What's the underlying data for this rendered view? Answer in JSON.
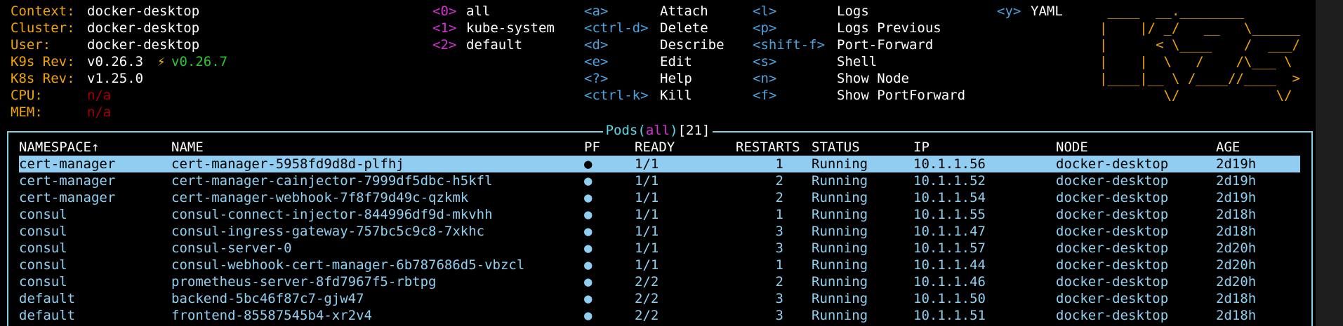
{
  "info": [
    {
      "label": "Context:",
      "value": "docker-desktop"
    },
    {
      "label": "Cluster:",
      "value": "docker-desktop"
    },
    {
      "label": "User:",
      "value": "docker-desktop"
    },
    {
      "label": "K9s Rev:",
      "value": "v0.26.3",
      "upgrade_icon": "⚡",
      "upgrade": "v0.26.7"
    },
    {
      "label": "K8s Rev:",
      "value": "v1.25.0"
    },
    {
      "label": "CPU:",
      "value": "n/a"
    },
    {
      "label": "MEM:",
      "value": "n/a"
    }
  ],
  "namespaces": [
    {
      "key": "<0>",
      "name": "all"
    },
    {
      "key": "<1>",
      "name": "kube-system"
    },
    {
      "key": "<2>",
      "name": "default"
    }
  ],
  "shortcuts_col1": [
    {
      "key": "<a>",
      "cmd": "Attach"
    },
    {
      "key": "<ctrl-d>",
      "cmd": "Delete"
    },
    {
      "key": "<d>",
      "cmd": "Describe"
    },
    {
      "key": "<e>",
      "cmd": "Edit"
    },
    {
      "key": "<?>",
      "cmd": "Help"
    },
    {
      "key": "<ctrl-k>",
      "cmd": "Kill"
    }
  ],
  "shortcuts_col2": [
    {
      "key": "<l>",
      "cmd": "Logs"
    },
    {
      "key": "<p>",
      "cmd": "Logs Previous"
    },
    {
      "key": "<shift-f>",
      "cmd": "Port-Forward"
    },
    {
      "key": "<s>",
      "cmd": "Shell"
    },
    {
      "key": "<n>",
      "cmd": "Show Node"
    },
    {
      "key": "<f>",
      "cmd": "Show PortForward"
    }
  ],
  "shortcuts_col3": [
    {
      "key": "<y>",
      "cmd": "YAML"
    }
  ],
  "logo_lines": [
    " ____  __.________        ",
    "|    |/ _/   __   \\______ ",
    "|      < \\____    /  ___/ ",
    "|    |  \\   /    /\\___ \\  ",
    "|____|__ \\ /____//____  > ",
    "        \\/            \\/  "
  ],
  "pods_panel": {
    "resource": "Pods",
    "scope": "all",
    "count": "21"
  },
  "columns": {
    "namespace": "NAMESPACE↑",
    "name": "NAME",
    "pf": "PF",
    "ready": "READY",
    "restarts": "RESTARTS",
    "status": "STATUS",
    "ip": "IP",
    "node": "NODE",
    "age": "AGE"
  },
  "rows": [
    {
      "namespace": "cert-manager",
      "name": "cert-manager-5958fd9d8d-plfhj",
      "pf": "●",
      "ready": "1/1",
      "restarts": "1",
      "status": "Running",
      "ip": "10.1.1.56",
      "node": "docker-desktop",
      "age": "2d19h"
    },
    {
      "namespace": "cert-manager",
      "name": "cert-manager-cainjector-7999df5dbc-h5kfl",
      "pf": "●",
      "ready": "1/1",
      "restarts": "2",
      "status": "Running",
      "ip": "10.1.1.52",
      "node": "docker-desktop",
      "age": "2d19h"
    },
    {
      "namespace": "cert-manager",
      "name": "cert-manager-webhook-7f8f79d49c-qzkmk",
      "pf": "●",
      "ready": "1/1",
      "restarts": "2",
      "status": "Running",
      "ip": "10.1.1.54",
      "node": "docker-desktop",
      "age": "2d19h"
    },
    {
      "namespace": "consul",
      "name": "consul-connect-injector-844996df9d-mkvhh",
      "pf": "●",
      "ready": "1/1",
      "restarts": "1",
      "status": "Running",
      "ip": "10.1.1.55",
      "node": "docker-desktop",
      "age": "2d18h"
    },
    {
      "namespace": "consul",
      "name": "consul-ingress-gateway-757bc5c9c8-7xkhc",
      "pf": "●",
      "ready": "1/1",
      "restarts": "3",
      "status": "Running",
      "ip": "10.1.1.47",
      "node": "docker-desktop",
      "age": "2d18h"
    },
    {
      "namespace": "consul",
      "name": "consul-server-0",
      "pf": "●",
      "ready": "1/1",
      "restarts": "3",
      "status": "Running",
      "ip": "10.1.1.57",
      "node": "docker-desktop",
      "age": "2d20h"
    },
    {
      "namespace": "consul",
      "name": "consul-webhook-cert-manager-6b787686d5-vbzcl",
      "pf": "●",
      "ready": "1/1",
      "restarts": "1",
      "status": "Running",
      "ip": "10.1.1.44",
      "node": "docker-desktop",
      "age": "2d20h"
    },
    {
      "namespace": "consul",
      "name": "prometheus-server-8fd7967f5-rbtpg",
      "pf": "●",
      "ready": "2/2",
      "restarts": "2",
      "status": "Running",
      "ip": "10.1.1.46",
      "node": "docker-desktop",
      "age": "2d20h"
    },
    {
      "namespace": "default",
      "name": "backend-5bc46f87c7-gjw47",
      "pf": "●",
      "ready": "2/2",
      "restarts": "3",
      "status": "Running",
      "ip": "10.1.1.50",
      "node": "docker-desktop",
      "age": "2d18h"
    },
    {
      "namespace": "default",
      "name": "frontend-85587545b4-xr2v4",
      "pf": "●",
      "ready": "2/2",
      "restarts": "3",
      "status": "Running",
      "ip": "10.1.1.51",
      "node": "docker-desktop",
      "age": "2d18h"
    }
  ],
  "selected_row": 0
}
